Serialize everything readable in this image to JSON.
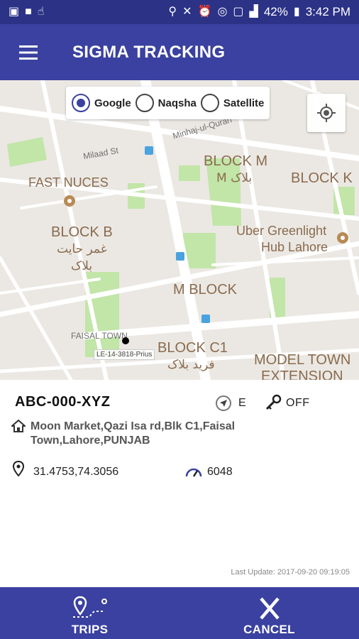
{
  "status_bar": {
    "battery": "42%",
    "time": "3:42 PM"
  },
  "app_bar": {
    "title": "SIGMA TRACKING",
    "menu_icon": "hamburger-menu-icon"
  },
  "map": {
    "type_options": [
      {
        "label": "Google",
        "selected": true
      },
      {
        "label": "Naqsha",
        "selected": false
      },
      {
        "label": "Satellite",
        "selected": false
      }
    ],
    "labels": {
      "minhaj": "Minhaj-ul-Quran",
      "milaad": "Milaad St",
      "block_m": "BLOCK M",
      "block_m_urdu": "M بلاک",
      "block_k": "BLOCK K",
      "fast_nuces": "FAST NUCES",
      "block_b": "BLOCK B",
      "block_b_urdu_1": "غمر حایت",
      "block_b_urdu_2": "بلاک",
      "uber_1": "Uber Greenlight",
      "uber_2": "Hub Lahore",
      "m_block": "M BLOCK",
      "faisal_town": "FAISAL TOWN",
      "block_c1": "BLOCK C1",
      "block_c1_urdu": "فرید بلاک",
      "model_town": "MODEL TOWN",
      "extension": "EXTENSION"
    },
    "vehicle_marker_label": "LE-14-3818-Prius",
    "colors": {
      "road": "#ffffff",
      "land": "#ebe8e3",
      "park": "#c2e5a8",
      "poi": "#b98a55"
    }
  },
  "vehicle": {
    "id": "ABC-000-XYZ",
    "direction": "E",
    "ignition": "OFF",
    "address": "Moon Market,Qazi Isa rd,Blk C1,Faisal Town,Lahore,PUNJAB",
    "coordinates": "31.4753,74.3056",
    "odometer": "6048",
    "last_update": "Last Update: 2017-09-20 09:19:05"
  },
  "bottom_bar": {
    "trips_label": "TRIPS",
    "cancel_label": "CANCEL"
  },
  "theme": {
    "primary": "#3a41a0",
    "status_bar": "#2c3286",
    "accent": "#3a41a0"
  }
}
